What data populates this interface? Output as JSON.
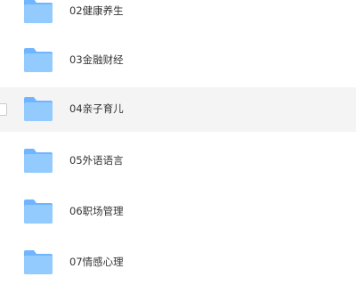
{
  "files": [
    {
      "name": "02健康养生",
      "icon": "folder-icon",
      "selected": false
    },
    {
      "name": "03金融财经",
      "icon": "folder-icon",
      "selected": false
    },
    {
      "name": "04亲子育儿",
      "icon": "folder-icon",
      "selected": true
    },
    {
      "name": "05外语语言",
      "icon": "folder-icon",
      "selected": false
    },
    {
      "name": "06职场管理",
      "icon": "folder-icon",
      "selected": false
    },
    {
      "name": "07情感心理",
      "icon": "folder-icon",
      "selected": false
    }
  ],
  "colors": {
    "folder_back": "#6fb5ff",
    "folder_front": "#93cbff",
    "selected_row": "#f4f4f5",
    "text": "#333333"
  }
}
